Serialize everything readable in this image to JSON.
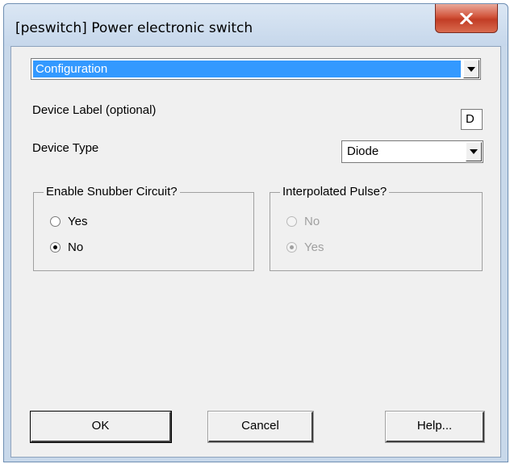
{
  "window": {
    "title": "[peswitch] Power electronic switch",
    "close_icon": "close-x-icon"
  },
  "page_selector": {
    "selected": "Configuration"
  },
  "device_label": {
    "label": "Device Label (optional)",
    "value": "D"
  },
  "device_type": {
    "label": "Device Type",
    "selected": "Diode"
  },
  "snubber_group": {
    "legend": "Enable Snubber Circuit?",
    "options": [
      {
        "label": "Yes",
        "checked": false,
        "enabled": true
      },
      {
        "label": "No",
        "checked": true,
        "enabled": true
      }
    ]
  },
  "interpolated_group": {
    "legend": "Interpolated Pulse?",
    "options": [
      {
        "label": "No",
        "checked": false,
        "enabled": false
      },
      {
        "label": "Yes",
        "checked": true,
        "enabled": false
      }
    ]
  },
  "buttons": {
    "ok": "OK",
    "cancel": "Cancel",
    "help": "Help..."
  }
}
